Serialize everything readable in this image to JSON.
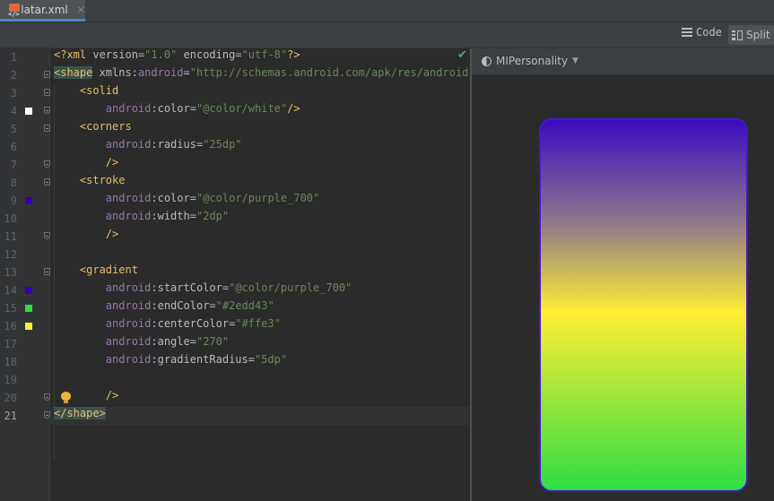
{
  "tab": {
    "filename": "latar.xml",
    "icon": "xml-file-icon",
    "close_glyph": "×"
  },
  "toolbar": {
    "code_label": "Code",
    "split_label": "Split"
  },
  "preview": {
    "theme_label": "MIPersonality"
  },
  "colors": {
    "white": "#ffffff",
    "purple_700": "#3700b3",
    "endColor": "#2edd43",
    "centerColor": "#ffe3"
  },
  "lines": [
    {
      "n": "1"
    },
    {
      "n": "2"
    },
    {
      "n": "3"
    },
    {
      "n": "4"
    },
    {
      "n": "5"
    },
    {
      "n": "6"
    },
    {
      "n": "7"
    },
    {
      "n": "8"
    },
    {
      "n": "9"
    },
    {
      "n": "10"
    },
    {
      "n": "11"
    },
    {
      "n": "12"
    },
    {
      "n": "13"
    },
    {
      "n": "14"
    },
    {
      "n": "15"
    },
    {
      "n": "16"
    },
    {
      "n": "17"
    },
    {
      "n": "18"
    },
    {
      "n": "19"
    },
    {
      "n": "20"
    },
    {
      "n": "21"
    }
  ],
  "code": {
    "l1": {
      "a": "<?xml ",
      "b": "version",
      "c": "=",
      "d": "\"1.0\"",
      "e": " encoding",
      "f": "=",
      "g": "\"utf-8\"",
      "h": "?>"
    },
    "l2": {
      "a": "<shape",
      "b": " xmlns:",
      "c": "android",
      "d": "=",
      "e": "\"http://schemas.android.com/apk/res/android\"",
      "f": ">"
    },
    "l3": {
      "a": "<solid"
    },
    "l4": {
      "ns": "android",
      "attr": ":color",
      "eq": "=",
      "val": "\"@color/white\"",
      "end": "/>"
    },
    "l5": {
      "a": "<corners"
    },
    "l6": {
      "ns": "android",
      "attr": ":radius",
      "eq": "=",
      "val": "\"25dp\""
    },
    "l7": {
      "a": "/>"
    },
    "l8": {
      "a": "<stroke"
    },
    "l9": {
      "ns": "android",
      "attr": ":color",
      "eq": "=",
      "val": "\"@color/purple_700\""
    },
    "l10": {
      "ns": "android",
      "attr": ":width",
      "eq": "=",
      "val": "\"2dp\""
    },
    "l11": {
      "a": "/>"
    },
    "l13": {
      "a": "<gradient"
    },
    "l14": {
      "ns": "android",
      "attr": ":startColor",
      "eq": "=",
      "val": "\"@color/purple_700\""
    },
    "l15": {
      "ns": "android",
      "attr": ":endColor",
      "eq": "=",
      "val": "\"#2edd43\""
    },
    "l16": {
      "ns": "android",
      "attr": ":centerColor",
      "eq": "=",
      "val": "\"#ffe3\""
    },
    "l17": {
      "ns": "android",
      "attr": ":angle",
      "eq": "=",
      "val": "\"270\""
    },
    "l18": {
      "ns": "android",
      "attr": ":gradientRadius",
      "eq": "=",
      "val": "\"5dp\""
    },
    "l20": {
      "a": "/>"
    },
    "l21": {
      "a": "</shape>"
    }
  }
}
